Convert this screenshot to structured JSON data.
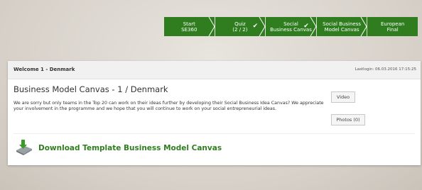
{
  "progress_steps": [
    {
      "line1": "Start",
      "line2": "SE360",
      "checked": false
    },
    {
      "line1": "Quiz",
      "line2": "(2 / 2)",
      "checked": true
    },
    {
      "line1": "Social",
      "line2": "Business Canvas",
      "checked": true
    },
    {
      "line1": "Social Business",
      "line2": "Model Canvas",
      "checked": false
    },
    {
      "line1": "European",
      "line2": "Final",
      "checked": false
    }
  ],
  "colors": {
    "accent_green": "#2f7d1f"
  },
  "panel": {
    "welcome": "Welcome 1 - Denmark",
    "lastlogin": "Lastlogin: 06.03.2016 17:15:25",
    "title": "Business Model Canvas - 1 / Denmark",
    "message": "We are sorry but only teams in the Top 20 can work on their ideas further by developing their Social Business Idea Canvas? We appreciate your involvement in the programme and we hope that you will continue to work on your social entrepreneurial ideas.",
    "video_button": "Video",
    "photos_button": "Photos (0)",
    "download_link": "Download Template Business Model Canvas",
    "download_icon": "download-icon"
  }
}
